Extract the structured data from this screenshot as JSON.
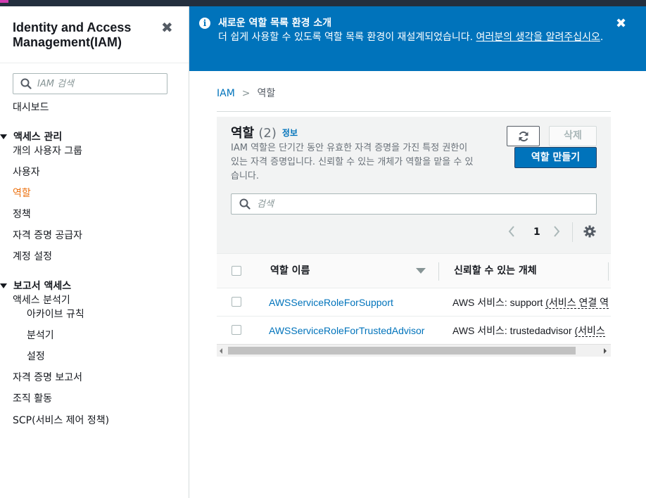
{
  "sidebar": {
    "title": "Identity and Access Management(IAM)",
    "search_placeholder": "IAM 검색",
    "dashboard": "대시보드",
    "access_mgmt": {
      "heading": "액세스 관리",
      "items": [
        "개의 사용자 그룹",
        "사용자",
        "역할",
        "정책",
        "자격 증명 공급자",
        "계정 설정"
      ]
    },
    "active_item": "역할",
    "access_reports": {
      "heading": "보고서 액세스",
      "analyzer": "액세스 분석기",
      "analyzer_sub": [
        "아카이브 규칙",
        "분석기",
        "설정"
      ],
      "items": [
        "자격 증명 보고서",
        "조직 활동",
        "SCP(서비스 제어 정책)"
      ]
    }
  },
  "flash": {
    "title": "새로운 역할 목록 환경 소개",
    "body": "더 쉽게 사용할 수 있도록 역할 목록 환경이 재설계되었습니다. ",
    "link": "여러분의 생각을 알려주십시오",
    "suffix": "."
  },
  "breadcrumb": {
    "root": "IAM",
    "current": "역할"
  },
  "roles_panel": {
    "title": "역할",
    "count": "(2)",
    "info": "정보",
    "description": "IAM 역할은 단기간 동안 유효한 자격 증명을 가진 특정 권한이 있는 자격 증명입니다. 신뢰할 수 있는 개체가 역할을 맡을 수 있습니다.",
    "delete_label": "삭제",
    "create_label": "역할 만들기",
    "search_placeholder": "검색",
    "page": "1"
  },
  "table": {
    "columns": [
      "역할 이름",
      "신뢰할 수 있는 개체"
    ],
    "rows": [
      {
        "name": "AWSServiceRoleForSupport",
        "trust_prefix": "AWS 서비스: support ",
        "trust_link": "(서비스 연결 역"
      },
      {
        "name": "AWSServiceRoleForTrustedAdvisor",
        "trust_prefix": "AWS 서비스: trustedadvisor ",
        "trust_link": "(서비스"
      }
    ]
  },
  "colors": {
    "banner": "#0073bb",
    "link": "#0073bb",
    "active_nav": "#ec7211",
    "primary_button": "#0073bb"
  }
}
